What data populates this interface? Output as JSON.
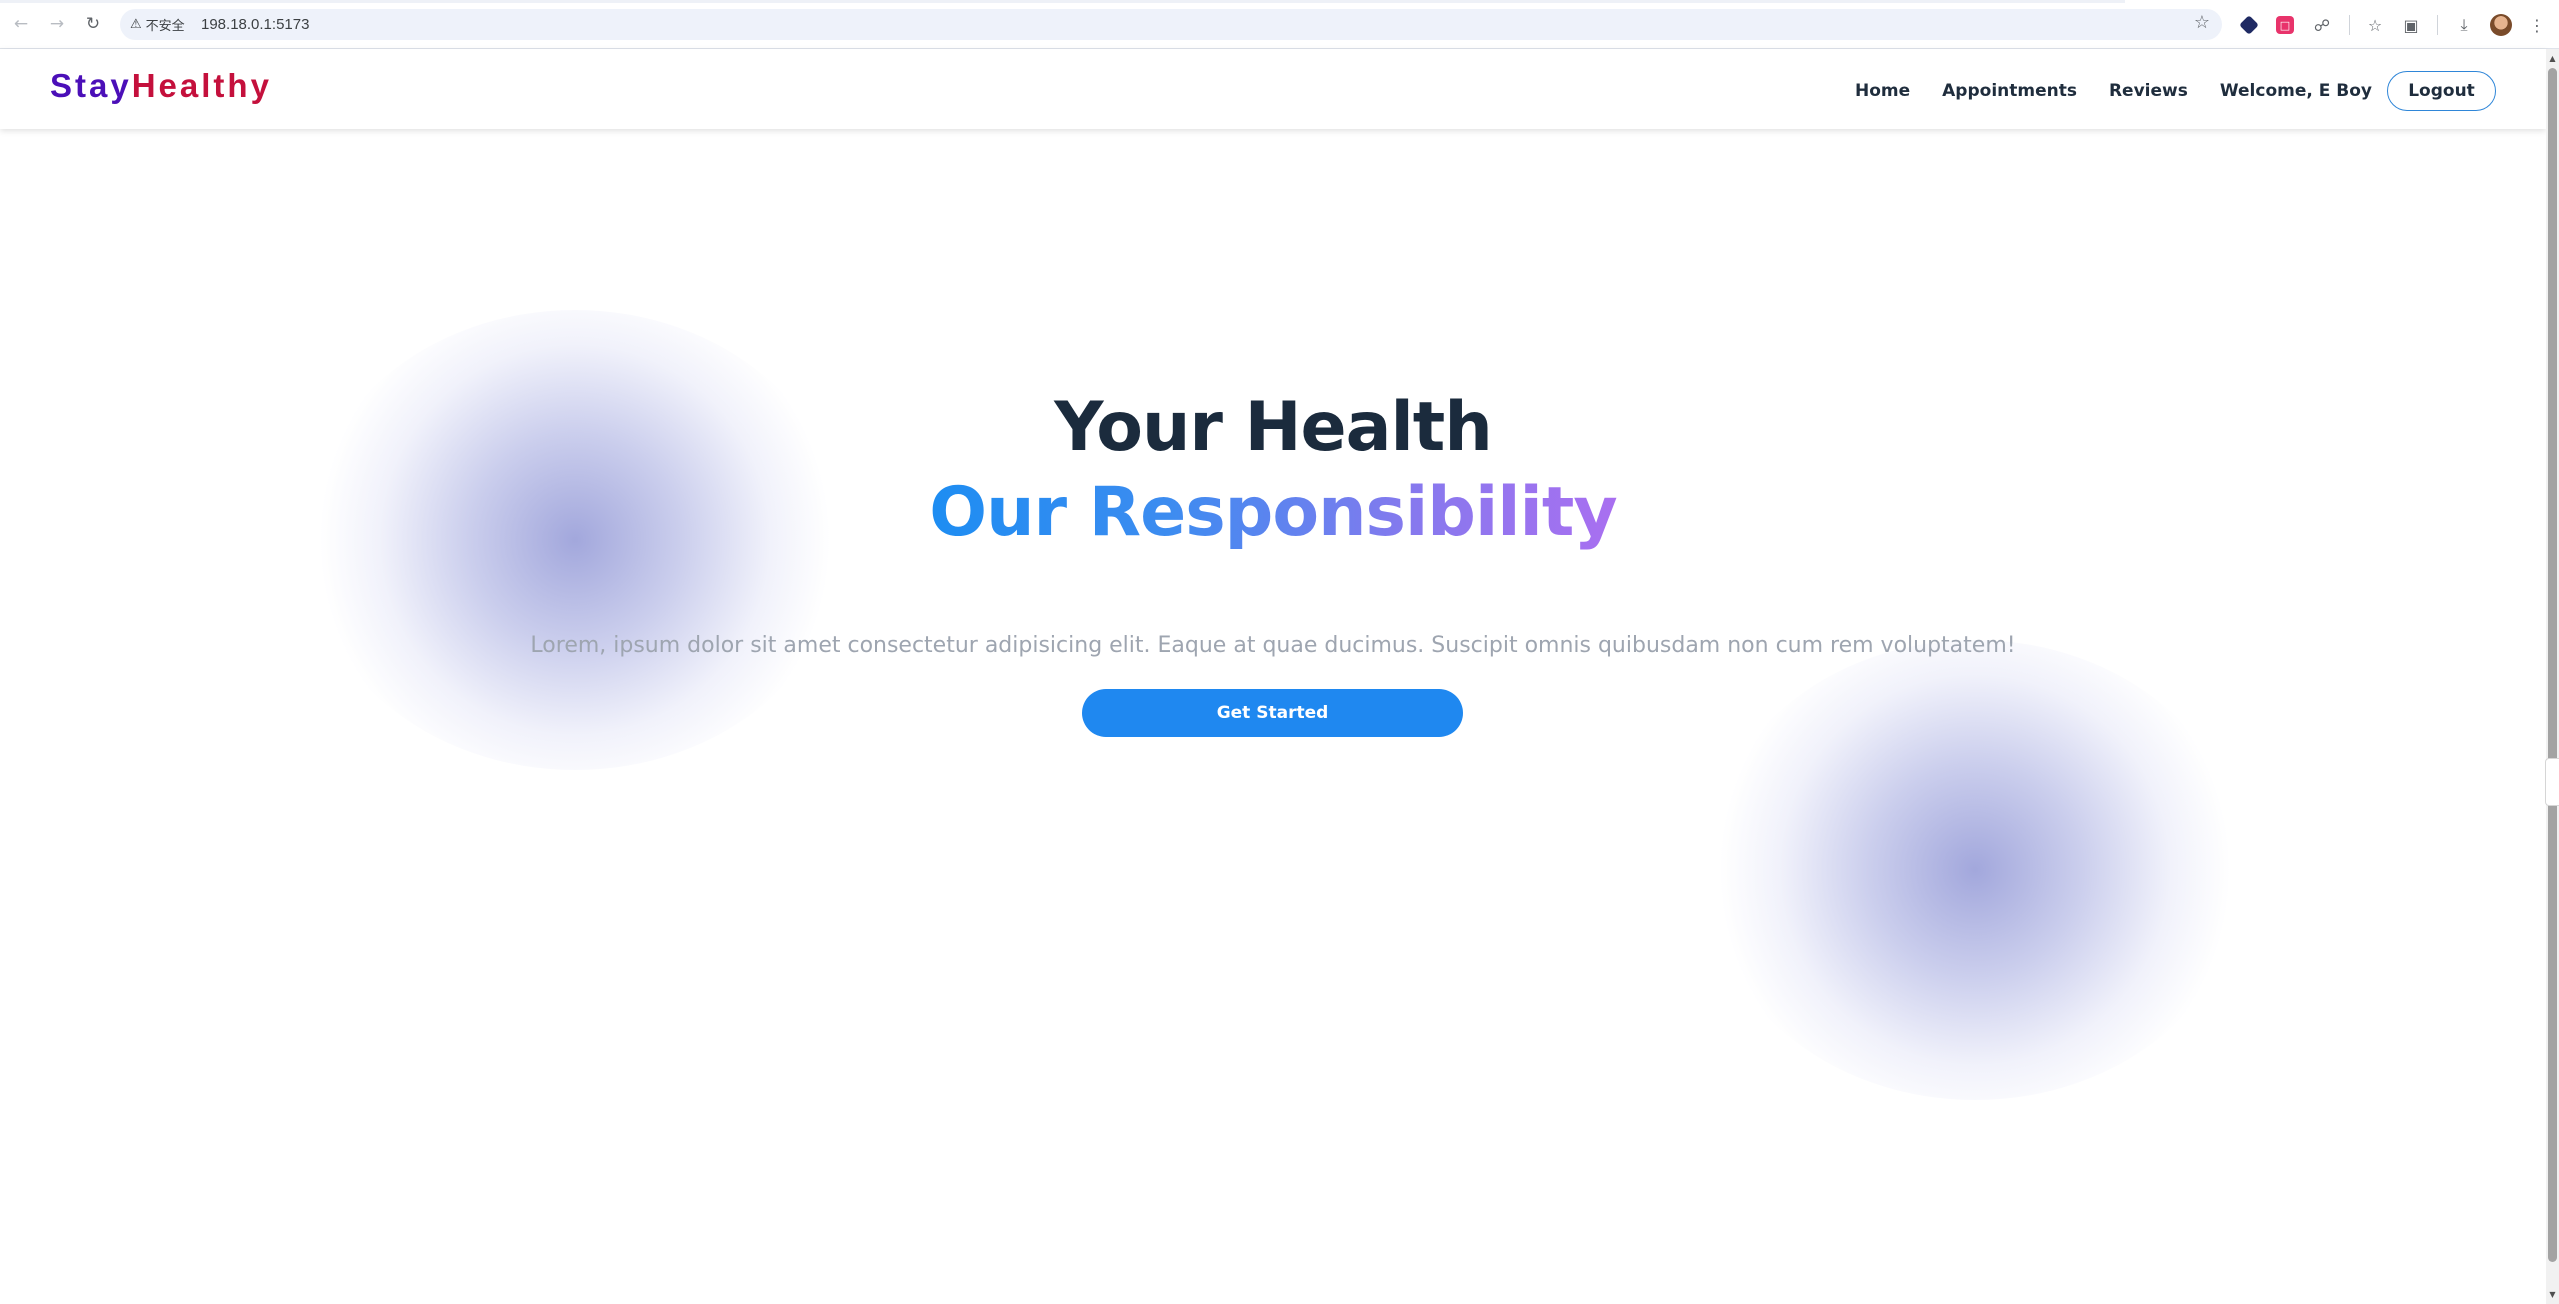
{
  "browser": {
    "security_label": "不安全",
    "url": "198.18.0.1:5173",
    "back_icon": "arrow-left",
    "forward_icon": "arrow-right",
    "reload_icon": "reload"
  },
  "header": {
    "logo_part1": "Stay",
    "logo_part2": "Healthy",
    "nav": {
      "home": "Home",
      "appointments": "Appointments",
      "reviews": "Reviews"
    },
    "welcome": "Welcome, E Boy",
    "logout": "Logout"
  },
  "hero": {
    "title_line1": "Your Health",
    "title_line2": "Our Responsibility",
    "subtitle": "Lorem, ipsum dolor sit amet consectetur adipisicing elit. Eaque at quae ducimus. Suscipit omnis quibusdam non cum rem voluptatem!",
    "cta": "Get Started"
  },
  "colors": {
    "logo_stay": "#4b0fb8",
    "logo_healthy": "#c4103c",
    "cta": "#1f88f0",
    "title": "#1b2b3d",
    "gradient_start": "#1d8df2",
    "gradient_end": "#a96ff0"
  }
}
